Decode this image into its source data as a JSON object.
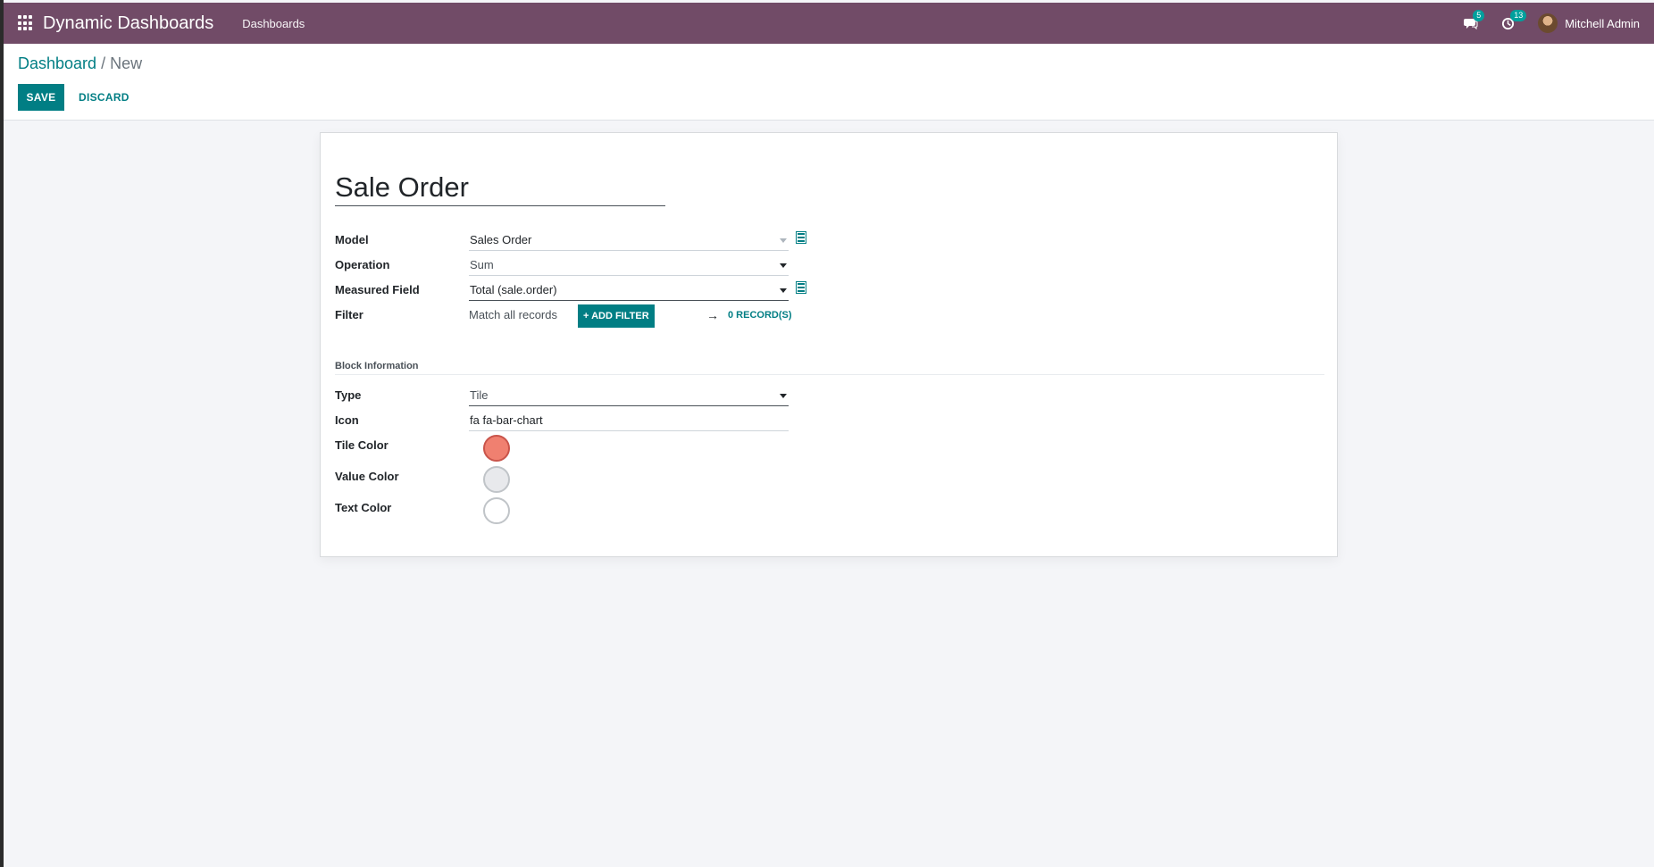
{
  "navbar": {
    "app_name": "Dynamic Dashboards",
    "menu_item": "Dashboards",
    "messages_count": "5",
    "activities_count": "13",
    "user_name": "Mitchell Admin"
  },
  "breadcrumb": {
    "parent": "Dashboard",
    "separator": " / ",
    "current": "New"
  },
  "toolbar": {
    "save_label": "SAVE",
    "discard_label": "DISCARD"
  },
  "form": {
    "title": "Sale Order",
    "model": {
      "label": "Model",
      "value": "Sales Order"
    },
    "operation": {
      "label": "Operation",
      "value": "Sum"
    },
    "measured_field": {
      "label": "Measured Field",
      "value": "Total (sale.order)"
    },
    "filter": {
      "label": "Filter",
      "text": "Match all records",
      "add_filter_label": "+ ADD FILTER",
      "records_label": "0 RECORD(S)"
    },
    "block_section_title": "Block Information",
    "type": {
      "label": "Type",
      "value": "Tile"
    },
    "icon": {
      "label": "Icon",
      "value": "fa fa-bar-chart"
    },
    "tile_color": {
      "label": "Tile Color",
      "color": "#f08070"
    },
    "value_color": {
      "label": "Value Color",
      "color": "#e8e9ec"
    },
    "text_color": {
      "label": "Text Color",
      "color": "#ffffff"
    }
  },
  "colors": {
    "navbar": "#714b67",
    "primary": "#017e84",
    "background": "#f4f5f8"
  }
}
